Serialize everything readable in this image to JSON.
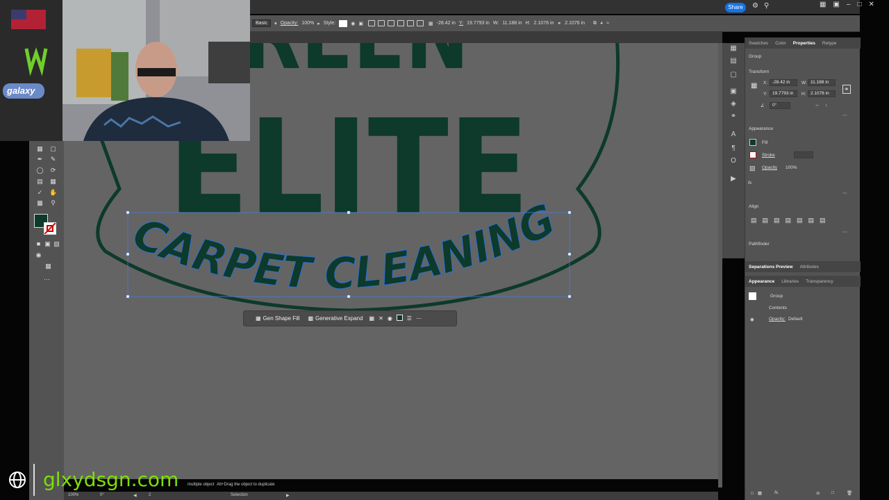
{
  "top_bar": {
    "share_label": "Share"
  },
  "control_bar": {
    "mode": "Basic",
    "opacity_label": "Opacity:",
    "opacity_value": "100%",
    "style_label": "Style:",
    "x_value": "-28.42 in",
    "y_label": "Y:",
    "y_value": "19.7793 in",
    "w_label": "W:",
    "w_value": "11.188 in",
    "h_label": "H:",
    "h_value": "2.1076 in"
  },
  "canvas": {
    "logo_line1": "REEN",
    "logo_line2": "ELITE",
    "selected_text": "CARPET CLEANING",
    "colors": {
      "logo_green": "#0d3a2a",
      "canvas_bg": "#646464",
      "selection_blue": "#4a7bd6"
    }
  },
  "context_bar": {
    "gen_shape_fill": "Gen Shape Fill",
    "generative_expand": "Generative Expand"
  },
  "properties_panel": {
    "tabs": [
      "Swatches",
      "Color",
      "Properties",
      "Retype"
    ],
    "active_tab": "Properties",
    "object_type": "Group",
    "transform_title": "Transform",
    "x_label": "X:",
    "x_value": "-28.42 in",
    "y_label": "Y:",
    "y_value": "19.7793 in",
    "w_label": "W:",
    "w_value": "11.188 in",
    "h_label": "H:",
    "h_value": "2.1076 in",
    "angle_value": "0°",
    "appearance_title": "Appearance",
    "fill_label": "Fill",
    "stroke_label": "Stroke",
    "opacity_label": "Opacity",
    "opacity_value": "100%",
    "fx_label": "fx.",
    "align_title": "Align",
    "pathfinder_title": "Pathfinder"
  },
  "separations_panel": {
    "tabs": [
      "Separations Preview",
      "Attributes"
    ]
  },
  "appearance_panel": {
    "tabs": [
      "Appearance",
      "Libraries",
      "Transparency"
    ],
    "group_label": "Group",
    "contents_label": "Contents",
    "opacity_label": "Opacity:",
    "opacity_value": "Default"
  },
  "status_bar": {
    "zoom": "100%",
    "rotation": "0°",
    "artboard": "2",
    "tool": "Selection",
    "hint1": "multiple object",
    "hint2": "Alt+Drag the object to duplicate"
  },
  "watermark": {
    "text": "glxydsgn.com"
  },
  "webcam": {
    "sticker_text": "galaxy"
  }
}
